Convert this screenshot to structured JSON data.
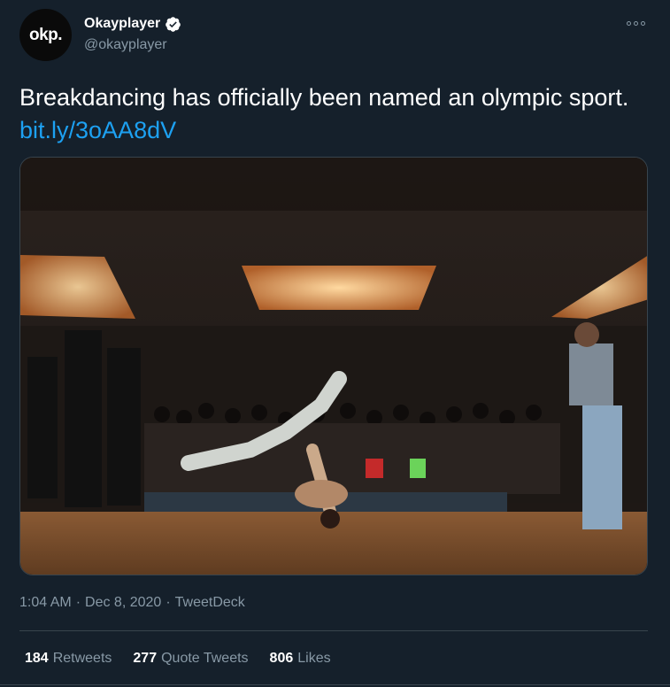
{
  "author": {
    "avatar_text": "okp.",
    "display_name": "Okayplayer",
    "handle": "@okayplayer",
    "verified": true
  },
  "tweet": {
    "text": "Breakdancing has officially been named an olympic sport.",
    "link": "bit.ly/3oAA8dV"
  },
  "meta": {
    "time": "1:04 AM",
    "separator": "·",
    "date": "Dec 8, 2020",
    "source": "TweetDeck"
  },
  "stats": {
    "retweets": {
      "count": "184",
      "label": "Retweets"
    },
    "quote_tweets": {
      "count": "277",
      "label": "Quote Tweets"
    },
    "likes": {
      "count": "806",
      "label": "Likes"
    }
  },
  "icons": {
    "verified": "verified-badge-icon",
    "more": "more-options-icon"
  },
  "colors": {
    "background": "#15202b",
    "link": "#1da1f2",
    "secondary_text": "#8899a6",
    "border": "#38444d"
  }
}
